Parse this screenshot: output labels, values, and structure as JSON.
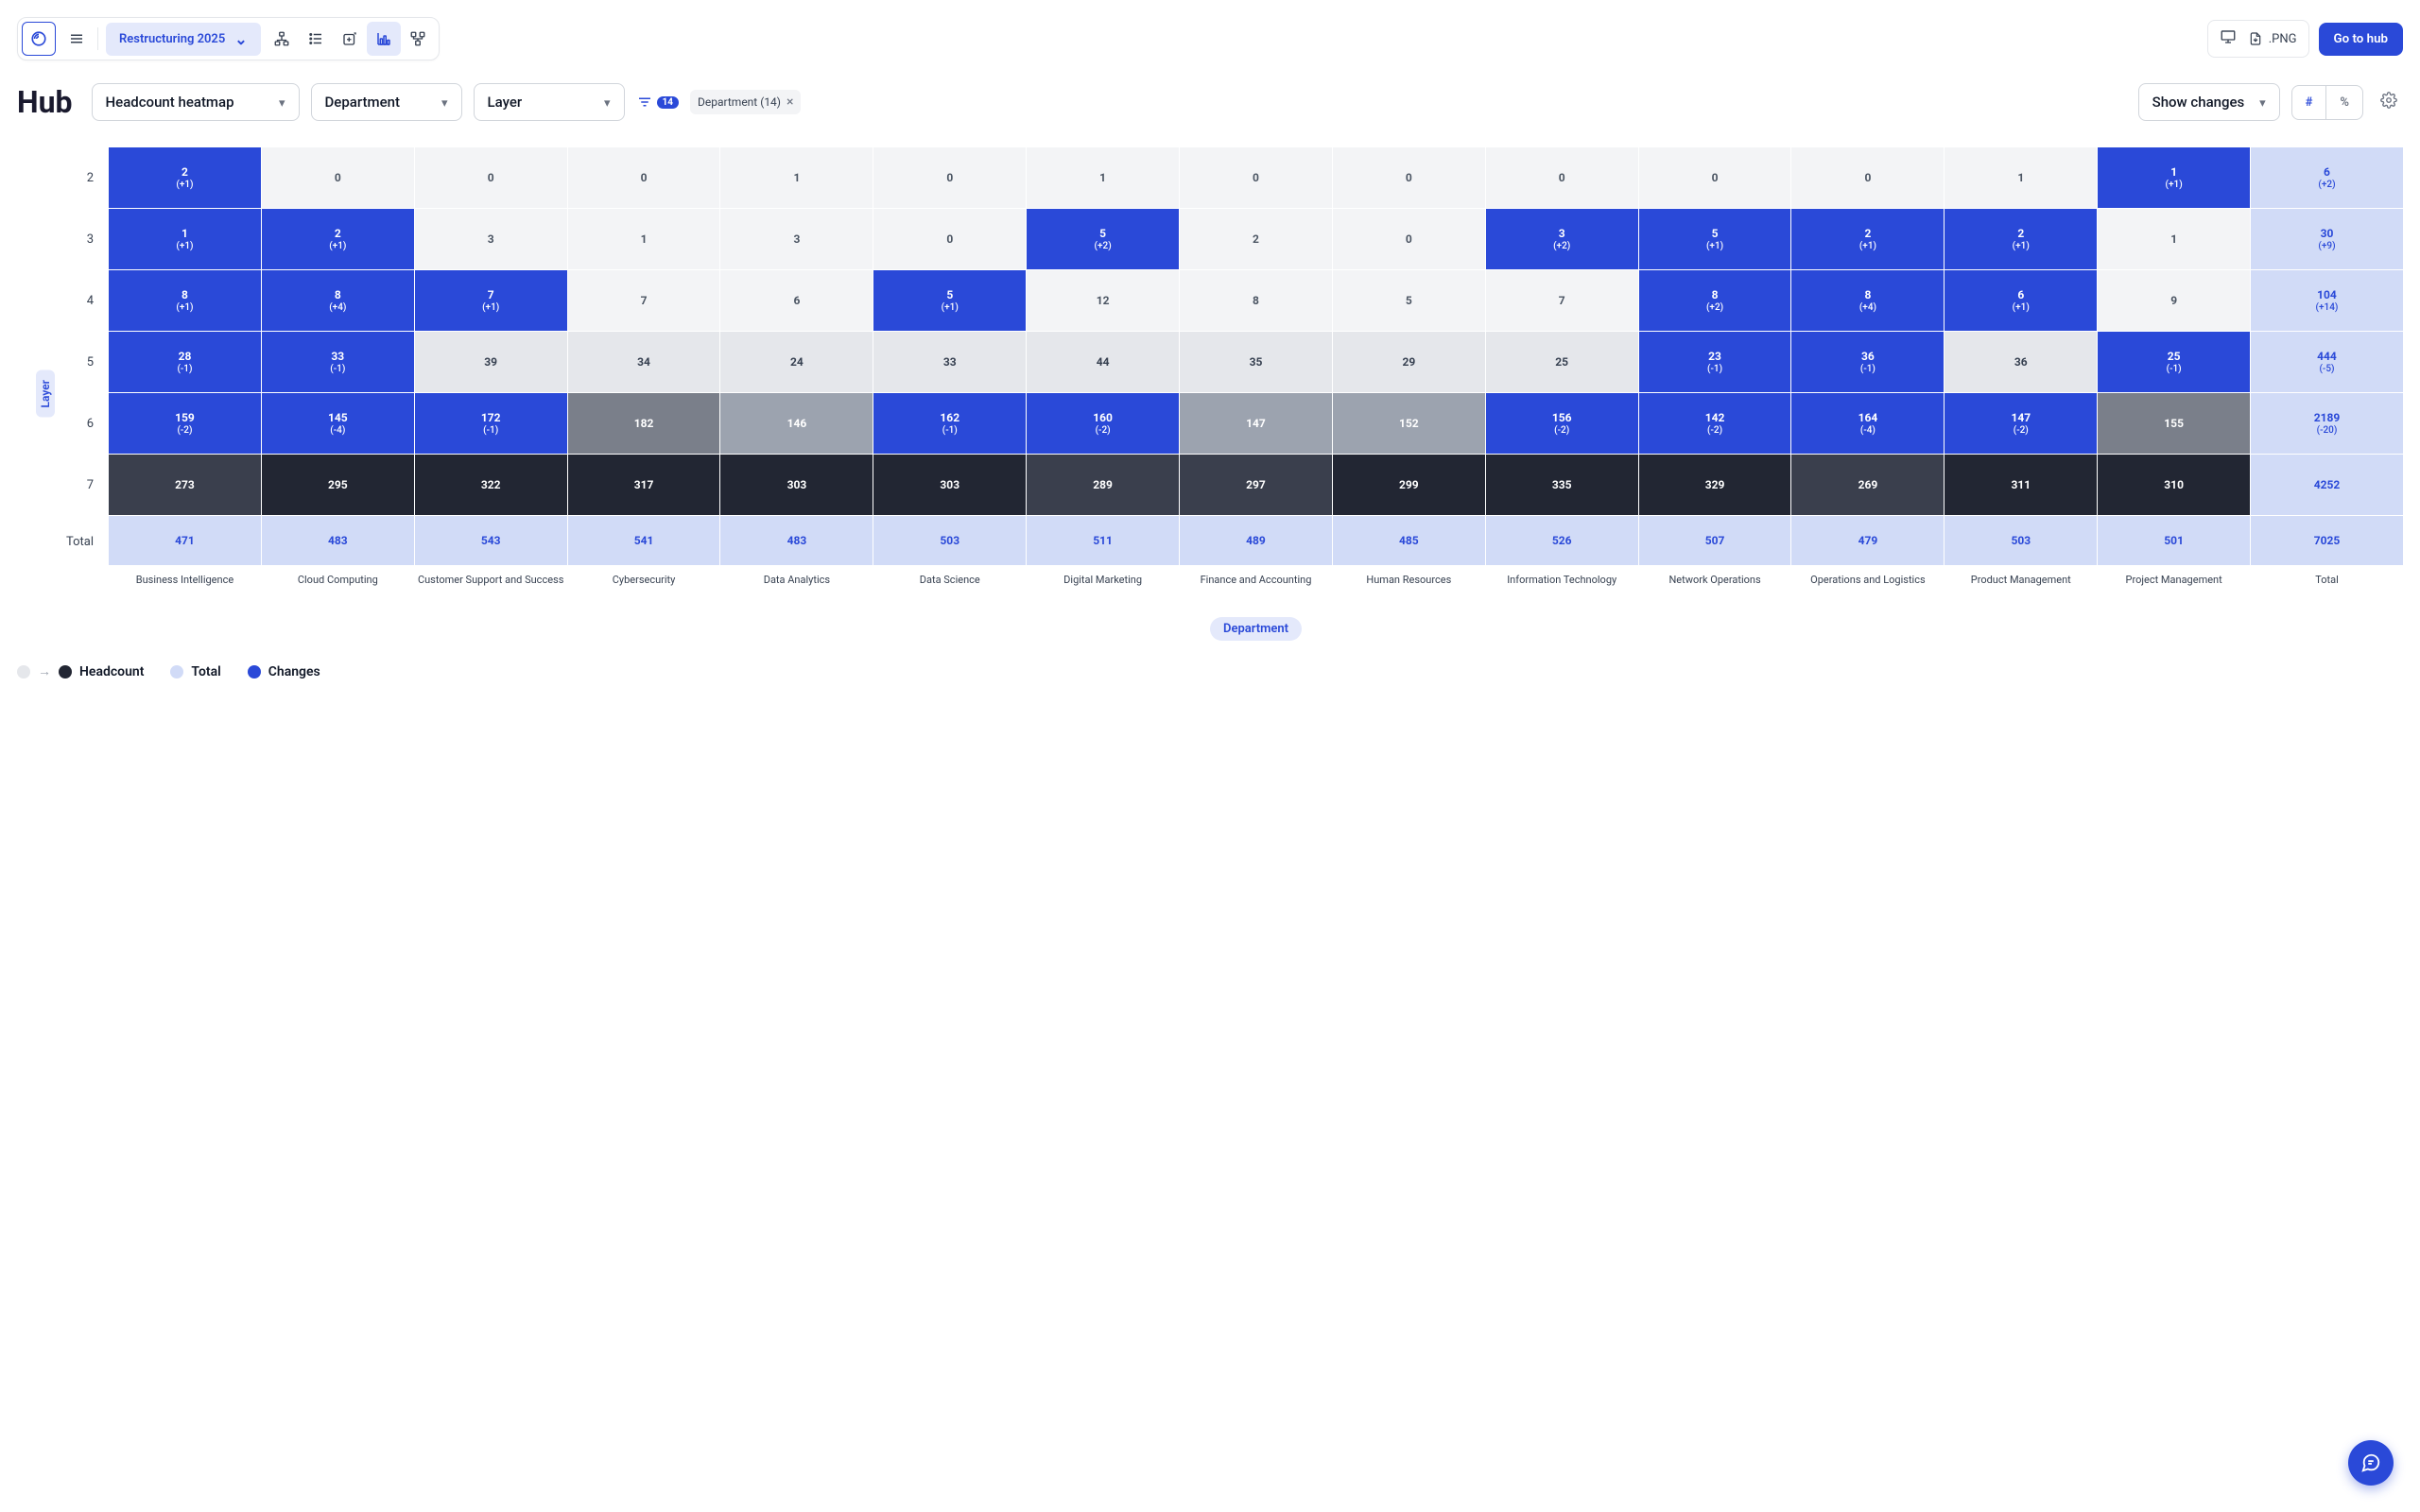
{
  "topbar": {
    "scenario_label": "Restructuring 2025",
    "png_label": ".PNG",
    "go_to_hub_label": "Go to hub"
  },
  "controls": {
    "page_title": "Hub",
    "view_select": "Headcount heatmap",
    "dim1_select": "Department",
    "dim2_select": "Layer",
    "filter_count": "14",
    "filter_chip_label": "Department (14)",
    "changes_select": "Show changes",
    "toggle_hash": "#",
    "toggle_pct": "%"
  },
  "axes": {
    "y_title": "Layer",
    "x_title": "Department",
    "row_labels": [
      "2",
      "3",
      "4",
      "5",
      "6",
      "7",
      "Total"
    ],
    "col_labels": [
      "Business Intelligence",
      "Cloud Computing",
      "Customer Support and Success",
      "Cybersecurity",
      "Data Analytics",
      "Data Science",
      "Digital Marketing",
      "Finance and Accounting",
      "Human Resources",
      "Information Technology",
      "Network Operations",
      "Operations and Logistics",
      "Product Management",
      "Project Management",
      "Total"
    ]
  },
  "legend": {
    "headcount": "Headcount",
    "total": "Total",
    "changes": "Changes"
  },
  "chart_data": {
    "type": "heatmap",
    "title": "Headcount heatmap",
    "y_title": "Layer",
    "x_title": "Department",
    "y_categories": [
      "2",
      "3",
      "4",
      "5",
      "6",
      "7"
    ],
    "x_categories": [
      "Business Intelligence",
      "Cloud Computing",
      "Customer Support and Success",
      "Cybersecurity",
      "Data Analytics",
      "Data Science",
      "Digital Marketing",
      "Finance and Accounting",
      "Human Resources",
      "Information Technology",
      "Network Operations",
      "Operations and Logistics",
      "Product Management",
      "Project Management"
    ],
    "rows": [
      {
        "layer": "2",
        "cells": [
          {
            "v": 2,
            "d": 1,
            "c": "change"
          },
          {
            "v": 0,
            "c": "l0"
          },
          {
            "v": 0,
            "c": "l0"
          },
          {
            "v": 0,
            "c": "l0"
          },
          {
            "v": 1,
            "c": "l0"
          },
          {
            "v": 0,
            "c": "l0"
          },
          {
            "v": 1,
            "c": "l0"
          },
          {
            "v": 0,
            "c": "l0"
          },
          {
            "v": 0,
            "c": "l0"
          },
          {
            "v": 0,
            "c": "l0"
          },
          {
            "v": 0,
            "c": "l0"
          },
          {
            "v": 0,
            "c": "l0"
          },
          {
            "v": 1,
            "c": "l0"
          },
          {
            "v": 1,
            "d": 1,
            "c": "change"
          }
        ],
        "total": {
          "v": 6,
          "d": 2
        }
      },
      {
        "layer": "3",
        "cells": [
          {
            "v": 1,
            "d": 1,
            "c": "change"
          },
          {
            "v": 2,
            "d": 1,
            "c": "change"
          },
          {
            "v": 3,
            "c": "l0"
          },
          {
            "v": 1,
            "c": "l0"
          },
          {
            "v": 3,
            "c": "l0"
          },
          {
            "v": 0,
            "c": "l0"
          },
          {
            "v": 5,
            "d": 2,
            "c": "change"
          },
          {
            "v": 2,
            "c": "l0"
          },
          {
            "v": 0,
            "c": "l0"
          },
          {
            "v": 3,
            "d": 2,
            "c": "change"
          },
          {
            "v": 5,
            "d": 1,
            "c": "change"
          },
          {
            "v": 2,
            "d": 1,
            "c": "change"
          },
          {
            "v": 2,
            "d": 1,
            "c": "change"
          },
          {
            "v": 1,
            "c": "l0"
          }
        ],
        "total": {
          "v": 30,
          "d": 9
        }
      },
      {
        "layer": "4",
        "cells": [
          {
            "v": 8,
            "d": 1,
            "c": "change"
          },
          {
            "v": 8,
            "d": 4,
            "c": "change"
          },
          {
            "v": 7,
            "d": 1,
            "c": "change"
          },
          {
            "v": 7,
            "c": "l0"
          },
          {
            "v": 6,
            "c": "l0"
          },
          {
            "v": 5,
            "d": 1,
            "c": "change"
          },
          {
            "v": 12,
            "c": "l0"
          },
          {
            "v": 8,
            "c": "l0"
          },
          {
            "v": 5,
            "c": "l0"
          },
          {
            "v": 7,
            "c": "l0"
          },
          {
            "v": 8,
            "d": 2,
            "c": "change"
          },
          {
            "v": 8,
            "d": 4,
            "c": "change"
          },
          {
            "v": 6,
            "d": 1,
            "c": "change"
          },
          {
            "v": 9,
            "c": "l0"
          }
        ],
        "total": {
          "v": 104,
          "d": 14
        }
      },
      {
        "layer": "5",
        "cells": [
          {
            "v": 28,
            "d": -1,
            "c": "change"
          },
          {
            "v": 33,
            "d": -1,
            "c": "change"
          },
          {
            "v": 39,
            "c": "l1"
          },
          {
            "v": 34,
            "c": "l1"
          },
          {
            "v": 24,
            "c": "l1"
          },
          {
            "v": 33,
            "c": "l1"
          },
          {
            "v": 44,
            "c": "l1"
          },
          {
            "v": 35,
            "c": "l1"
          },
          {
            "v": 29,
            "c": "l1"
          },
          {
            "v": 25,
            "c": "l1"
          },
          {
            "v": 23,
            "d": -1,
            "c": "change"
          },
          {
            "v": 36,
            "d": -1,
            "c": "change"
          },
          {
            "v": 36,
            "c": "l1"
          },
          {
            "v": 25,
            "d": -1,
            "c": "change"
          }
        ],
        "total": {
          "v": 444,
          "d": -5
        }
      },
      {
        "layer": "6",
        "cells": [
          {
            "v": 159,
            "d": -2,
            "c": "change"
          },
          {
            "v": 145,
            "d": -4,
            "c": "change"
          },
          {
            "v": 172,
            "d": -1,
            "c": "change"
          },
          {
            "v": 182,
            "c": "l3"
          },
          {
            "v": 146,
            "c": "l2"
          },
          {
            "v": 162,
            "d": -1,
            "c": "change"
          },
          {
            "v": 160,
            "d": -2,
            "c": "change"
          },
          {
            "v": 147,
            "c": "l2"
          },
          {
            "v": 152,
            "c": "l2"
          },
          {
            "v": 156,
            "d": -2,
            "c": "change"
          },
          {
            "v": 142,
            "d": -2,
            "c": "change"
          },
          {
            "v": 164,
            "d": -4,
            "c": "change"
          },
          {
            "v": 147,
            "d": -2,
            "c": "change"
          },
          {
            "v": 155,
            "c": "l3"
          }
        ],
        "total": {
          "v": 2189,
          "d": -20
        }
      },
      {
        "layer": "7",
        "cells": [
          {
            "v": 273,
            "c": "l4"
          },
          {
            "v": 295,
            "c": "l5"
          },
          {
            "v": 322,
            "c": "l5"
          },
          {
            "v": 317,
            "c": "l5"
          },
          {
            "v": 303,
            "c": "l5"
          },
          {
            "v": 303,
            "c": "l5"
          },
          {
            "v": 289,
            "c": "l4"
          },
          {
            "v": 297,
            "c": "l4"
          },
          {
            "v": 299,
            "c": "l5"
          },
          {
            "v": 335,
            "c": "l5"
          },
          {
            "v": 329,
            "c": "l5"
          },
          {
            "v": 269,
            "c": "l4"
          },
          {
            "v": 311,
            "c": "l5"
          },
          {
            "v": 310,
            "c": "l5"
          }
        ],
        "total": {
          "v": 4252
        }
      }
    ],
    "col_totals": [
      471,
      483,
      543,
      541,
      483,
      503,
      511,
      489,
      485,
      526,
      507,
      479,
      503,
      501
    ],
    "grand_total": 7025
  }
}
